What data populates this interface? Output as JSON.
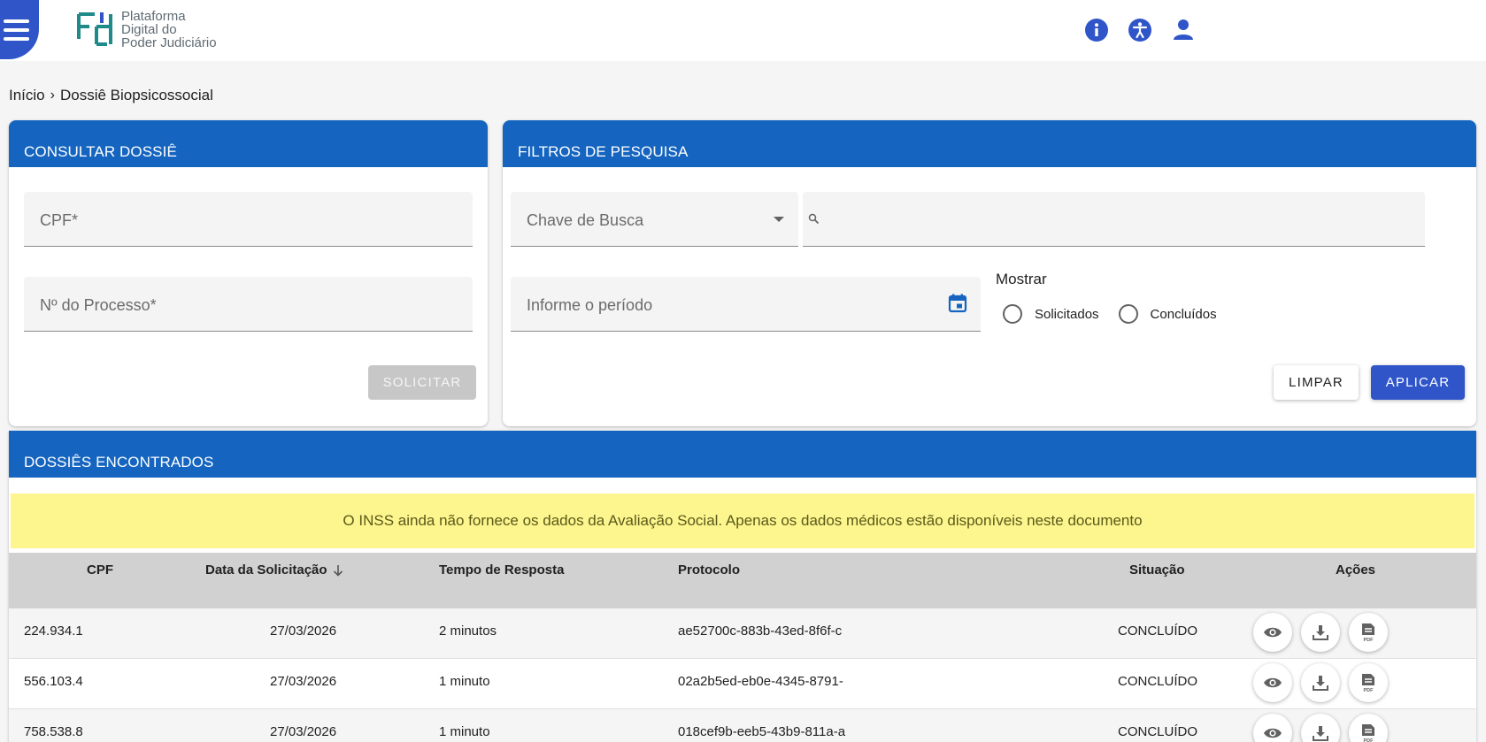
{
  "header": {
    "logo_text": [
      "Plataforma",
      "Digital do",
      "Poder Judiciário"
    ]
  },
  "breadcrumb": {
    "home": "Início",
    "current": "Dossiê Biopsicossocial"
  },
  "consultar": {
    "title": "CONSULTAR DOSSIÊ",
    "cpf_label": "CPF*",
    "processo_label": "Nº do Processo*",
    "solicitar_label": "SOLICITAR"
  },
  "filtros": {
    "title": "FILTROS DE PESQUISA",
    "chave_label": "Chave de Busca",
    "busca_value": "",
    "periodo_label": "Informe o período",
    "mostrar_label": "Mostrar",
    "radio_solicitados": "Solicitados",
    "radio_concluidos": "Concluídos",
    "limpar_label": "LIMPAR",
    "aplicar_label": "APLICAR"
  },
  "dossies": {
    "title": "DOSSIÊS ENCONTRADOS",
    "alert": "O INSS ainda não fornece os dados da Avaliação Social. Apenas os dados médicos estão disponíveis neste documento",
    "columns": {
      "cpf": "CPF",
      "data": "Data da Solicitação",
      "tempo": "Tempo de Resposta",
      "protocolo": "Protocolo",
      "situacao": "Situação",
      "acoes": "Ações"
    },
    "rows": [
      {
        "cpf": "224.934.1",
        "data": "27/03/2026",
        "tempo": "2 minutos",
        "protocolo": "ae52700c-883b-43ed-8f6f-c",
        "situacao": "CONCLUÍDO"
      },
      {
        "cpf": "556.103.4",
        "data": "27/03/2026",
        "tempo": "1 minuto",
        "protocolo": "02a2b5ed-eb0e-4345-8791-",
        "situacao": "CONCLUÍDO"
      },
      {
        "cpf": "758.538.8",
        "data": "27/03/2026",
        "tempo": "1 minuto",
        "protocolo": "018cef9b-eeb5-43b9-811a-a",
        "situacao": "CONCLUÍDO"
      }
    ]
  },
  "colors": {
    "primary_header": "#1565c0",
    "button_primary": "#2f55c9",
    "alert_bg": "#fdf58e",
    "table_header_bg": "#d1d1d1"
  }
}
